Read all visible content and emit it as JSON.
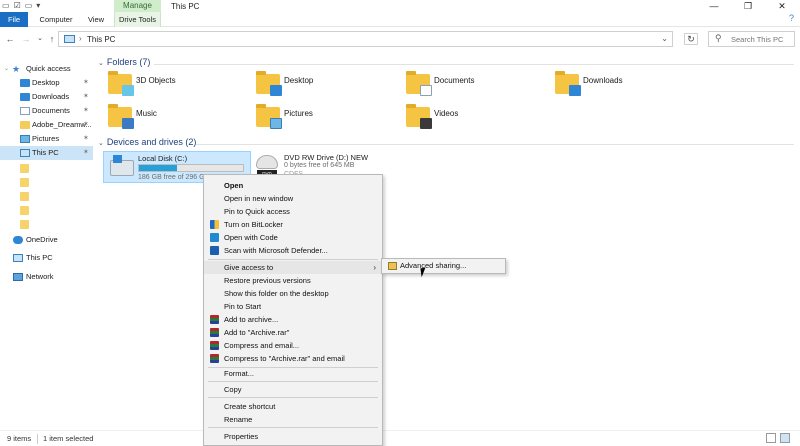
{
  "window": {
    "title": "This PC",
    "manage_tab": "Manage",
    "controls": {
      "minimize": "—",
      "maximize": "❐",
      "close": "✕"
    }
  },
  "ribbon": {
    "tabs": [
      "File",
      "Computer",
      "View",
      "Drive Tools"
    ],
    "help_icon": "?"
  },
  "address": {
    "path": "This PC",
    "search_placeholder": "Search This PC"
  },
  "sidebar": {
    "items": [
      {
        "label": "Quick access"
      },
      {
        "label": "Desktop"
      },
      {
        "label": "Downloads"
      },
      {
        "label": "Documents"
      },
      {
        "label": "Adobe_Dreamw..."
      },
      {
        "label": "Pictures"
      },
      {
        "label": "This PC"
      },
      {
        "label": "OneDrive"
      },
      {
        "label": "This PC"
      },
      {
        "label": "Network"
      }
    ]
  },
  "content": {
    "folders_header": "Folders (7)",
    "folders": [
      "3D Objects",
      "Desktop",
      "Documents",
      "Downloads",
      "Music",
      "Pictures",
      "Videos"
    ],
    "drives_header": "Devices and drives (2)",
    "drives": [
      {
        "name": "Local Disk (C:)",
        "size_text": "186 GB free of 296 GB",
        "used_fraction": 0.37
      },
      {
        "name": "DVD RW Drive (D:) NEW",
        "size_text": "0 bytes free of 645 MB",
        "label": "CDFS"
      }
    ]
  },
  "context_menu": {
    "items": [
      "Open",
      "Open in new window",
      "Pin to Quick access",
      "Turn on BitLocker",
      "Open with Code",
      "Scan with Microsoft Defender...",
      "Give access to",
      "Restore previous versions",
      "Show this folder on the desktop",
      "Pin to Start",
      "Add to archive...",
      "Add to \"Archive.rar\"",
      "Compress and email...",
      "Compress to \"Archive.rar\" and email",
      "Format...",
      "Copy",
      "Create shortcut",
      "Rename",
      "Properties"
    ],
    "submenu": [
      "Advanced sharing..."
    ]
  },
  "status": {
    "items_count": "9 items",
    "selected": "1 item selected"
  }
}
